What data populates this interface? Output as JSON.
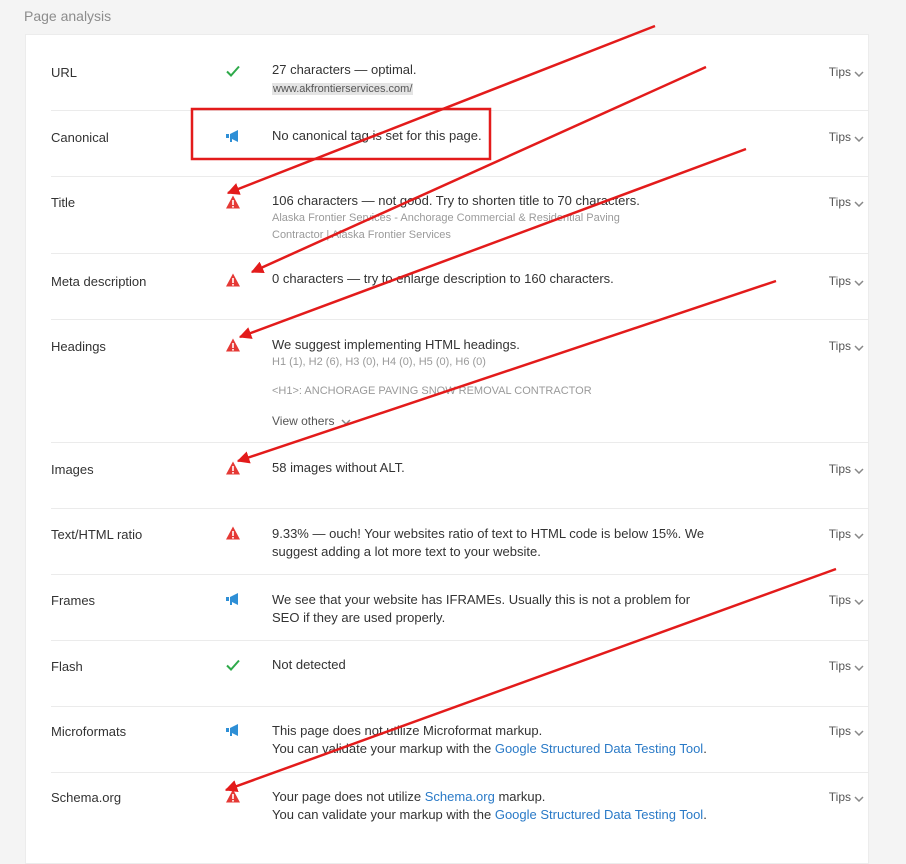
{
  "section_title": "Page analysis",
  "tips_label": "Tips",
  "colors": {
    "ok": "#2eaa4a",
    "warn": "#e53935",
    "info": "#2e8fd6",
    "link": "#2a7ac7",
    "annotation": "#e31b1b"
  },
  "rows": {
    "url": {
      "label": "URL",
      "status": "check-icon",
      "text": "27 characters — optimal.",
      "url": "www.akfrontierservices.com/"
    },
    "canonical": {
      "label": "Canonical",
      "status": "megaphone-icon",
      "text": "No canonical tag is set for this page."
    },
    "title": {
      "label": "Title",
      "status": "warning-icon",
      "text": "106 characters — not good. Try to shorten title to 70 characters.",
      "sub1": "Alaska Frontier Services - Anchorage Commercial & Residential Paving",
      "sub2": "Contractor | Alaska Frontier Services"
    },
    "meta": {
      "label": "Meta description",
      "status": "warning-icon",
      "text": "0 characters — try to enlarge description to 160 characters."
    },
    "headings": {
      "label": "Headings",
      "status": "warning-icon",
      "text": "We suggest implementing HTML headings.",
      "counts": "H1 (1), H2 (6), H3 (0), H4 (0), H5 (0), H6 (0)",
      "h1": "<H1>: ANCHORAGE PAVING SNOW REMOVAL CONTRACTOR",
      "view_others": "View others"
    },
    "images": {
      "label": "Images",
      "status": "warning-icon",
      "text": "58 images without ALT."
    },
    "ratio": {
      "label": "Text/HTML ratio",
      "status": "warning-icon",
      "line1": "9.33% — ouch! Your websites ratio of text to HTML code is below 15%. We",
      "line2": "suggest adding a lot more text to your website."
    },
    "frames": {
      "label": "Frames",
      "status": "megaphone-icon",
      "line1": "We see that your website has IFRAMEs. Usually this is not a problem for",
      "line2": "SEO if they are used properly."
    },
    "flash": {
      "label": "Flash",
      "status": "check-icon",
      "text": "Not detected"
    },
    "microformats": {
      "label": "Microformats",
      "status": "megaphone-icon",
      "line1": "This page does not utilize Microformat markup.",
      "line2_pre": "You can validate your markup with the ",
      "line2_link": "Google Structured Data Testing Tool",
      "line2_post": "."
    },
    "schema": {
      "label": "Schema.org",
      "status": "warning-icon",
      "line1_pre": "Your page does not utilize ",
      "line1_link": "Schema.org",
      "line1_post": " markup.",
      "line2_pre": "You can validate your markup with the ",
      "line2_link": "Google Structured Data Testing Tool",
      "line2_post": "."
    }
  }
}
